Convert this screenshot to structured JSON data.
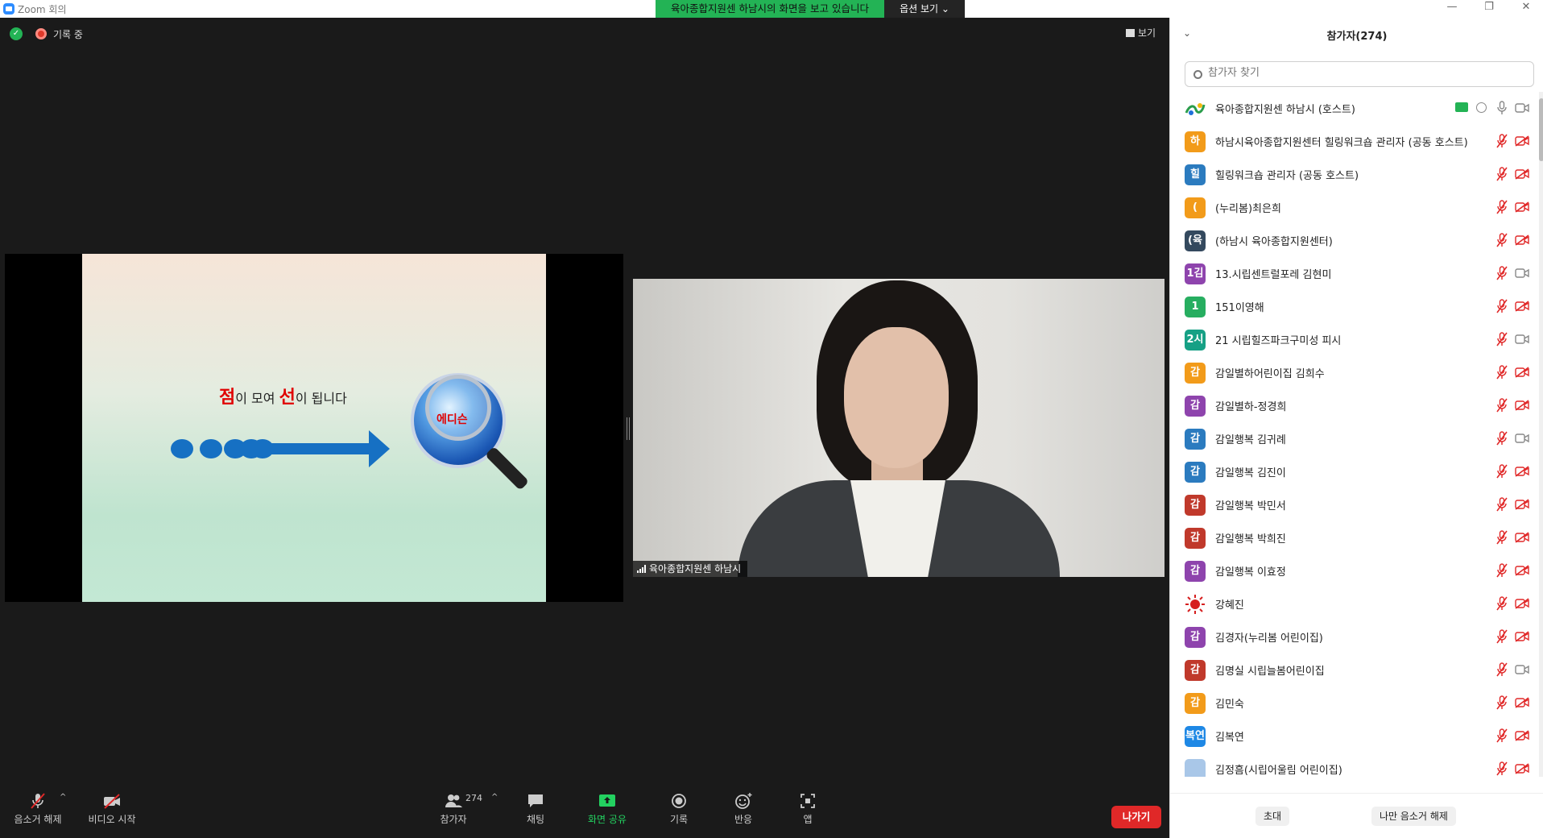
{
  "window": {
    "title": "Zoom 회의",
    "share_banner": "육아종합지원센 하남시의 화면을 보고 있습니다",
    "view_options": "옵션 보기 ⌄",
    "min_icon": "minimize-icon",
    "max_icon": "maximize-icon",
    "close_icon": "close-icon"
  },
  "stage": {
    "recording_label": "기록 중",
    "view_label": "보기"
  },
  "slide": {
    "text_part1": "점",
    "text_part2": "이 모여 ",
    "text_part3": "선",
    "text_part4": "이 됩니다",
    "globe_label": "에디슨"
  },
  "video": {
    "speaker_name": "육아종합지원센 하남시"
  },
  "toolbar": {
    "unmute": "음소거 해제",
    "start_video": "비디오 시작",
    "participants": "참가자",
    "participants_count": "274",
    "chat": "채팅",
    "share_screen": "화면 공유",
    "record": "기록",
    "reactions": "반응",
    "apps": "앱",
    "leave": "나가기"
  },
  "panel": {
    "title": "참가자(274)",
    "search_placeholder": "참가자 찾기",
    "invite": "초대",
    "unmute_me": "나만 음소거 해제",
    "participants": [
      {
        "initial": "",
        "name": "육아종합지원센 하남시 (호스트)",
        "color": "#ffffff",
        "mic_muted": false,
        "cam_off": false,
        "host": true
      },
      {
        "initial": "하",
        "name": "하남시육아종합지원센터 힐링워크숍 관리자 (공동 호스트)",
        "color": "#f29b1a",
        "mic_muted": true,
        "cam_off": true
      },
      {
        "initial": "힐",
        "name": "힐링워크숍 관리자 (공동 호스트)",
        "color": "#2b7bbf",
        "mic_muted": true,
        "cam_off": true
      },
      {
        "initial": "(",
        "name": "(누리봄)최은희",
        "color": "#f29b1a",
        "mic_muted": true,
        "cam_off": true
      },
      {
        "initial": "(육",
        "name": "(하남시 육아종합지원센터)",
        "color": "#34495e",
        "mic_muted": true,
        "cam_off": true
      },
      {
        "initial": "1김",
        "name": "13.시립센트럴포레 김현미",
        "color": "#8e44ad",
        "mic_muted": true,
        "cam_off": false
      },
      {
        "initial": "1",
        "name": "151이영해",
        "color": "#27ae60",
        "mic_muted": true,
        "cam_off": true
      },
      {
        "initial": "2시",
        "name": "21 시립힐즈파크구미성 피시",
        "color": "#16a085",
        "mic_muted": true,
        "cam_off": false
      },
      {
        "initial": "감",
        "name": "감일별하어린이집 김희수",
        "color": "#f29b1a",
        "mic_muted": true,
        "cam_off": true
      },
      {
        "initial": "감",
        "name": "감일별하-정경희",
        "color": "#8e44ad",
        "mic_muted": true,
        "cam_off": true
      },
      {
        "initial": "감",
        "name": "감일행복 김귀례",
        "color": "#2b7bbf",
        "mic_muted": true,
        "cam_off": false
      },
      {
        "initial": "감",
        "name": "감일행복 김진이",
        "color": "#2b7bbf",
        "mic_muted": true,
        "cam_off": true
      },
      {
        "initial": "감",
        "name": "감일행복 박민서",
        "color": "#c0392b",
        "mic_muted": true,
        "cam_off": true
      },
      {
        "initial": "감",
        "name": "감일행복 박희진",
        "color": "#c0392b",
        "mic_muted": true,
        "cam_off": true
      },
      {
        "initial": "감",
        "name": "감일행복 이효정",
        "color": "#8e44ad",
        "mic_muted": true,
        "cam_off": true
      },
      {
        "initial": "",
        "name": "강혜진",
        "color": "#ffffff",
        "mic_muted": true,
        "cam_off": true,
        "sun": true
      },
      {
        "initial": "감",
        "name": "김경자(누리봄 어린이집)",
        "color": "#8e44ad",
        "mic_muted": true,
        "cam_off": true
      },
      {
        "initial": "감",
        "name": "김명실 시립늘봄어린이집",
        "color": "#c0392b",
        "mic_muted": true,
        "cam_off": false
      },
      {
        "initial": "감",
        "name": "김민숙",
        "color": "#f29b1a",
        "mic_muted": true,
        "cam_off": true
      },
      {
        "initial": "복연",
        "name": "김복연",
        "color": "#1e88e5",
        "mic_muted": true,
        "cam_off": true
      },
      {
        "initial": "",
        "name": "김정흠(시립어울림 어린이집)",
        "color": "#a9c7e8",
        "mic_muted": true,
        "cam_off": true
      }
    ]
  }
}
